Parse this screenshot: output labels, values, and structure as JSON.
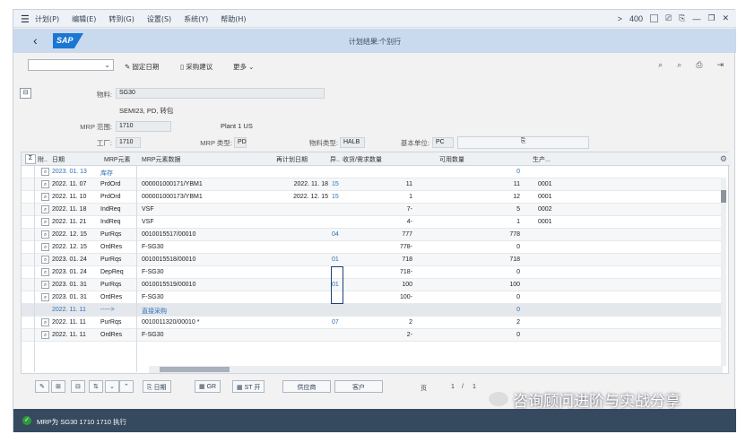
{
  "menubar": {
    "items": [
      "计划(P)",
      "编辑(E)",
      "转到(G)",
      "设置(S)",
      "系统(Y)",
      "帮助(H)"
    ],
    "right": {
      "chevron": ">",
      "zoom": "400"
    }
  },
  "header": {
    "title": "计划结果:个别行",
    "logo": "SAP"
  },
  "toolbar": {
    "fix_date": "固定日期",
    "purchase_suggestion": "采购建议",
    "more": "更多"
  },
  "form": {
    "material_label": "物料:",
    "material_value": "SG30",
    "material_desc": "SEMI23, PD, 转包",
    "mrp_area_label": "MRP 范围:",
    "mrp_area_value": "1710",
    "mrp_area_desc": "Plant 1 US",
    "plant_label": "工厂:",
    "plant_value": "1710",
    "mrp_type_label": "MRP 类型:",
    "mrp_type_value": "PD",
    "material_type_label": "物料类型:",
    "material_type_value": "HALB",
    "base_unit_label": "基本单位:",
    "base_unit_value": "PC"
  },
  "table": {
    "headers": {
      "sigma": "Σ",
      "flag": "附..",
      "date": "日期",
      "mrp_elem": "MRP元素",
      "mrp_data": "MRP元素数据",
      "resched": "再计划日期",
      "exc": "异..",
      "recv_req": "收货/需求数量",
      "avail": "可用数量",
      "prod": "生产..."
    },
    "rows": [
      {
        "date": "2023. 01. 13",
        "elem": "库存",
        "data": "",
        "resched": "",
        "exc": "",
        "qty": "",
        "avail": "0",
        "prod": "",
        "blue": true
      },
      {
        "date": "2022. 11. 07",
        "elem": "PrdOrd",
        "data": "000001000171/YBM1",
        "resched": "2022. 11. 18",
        "exc": "15",
        "qty": "11",
        "avail": "11",
        "prod": "0001"
      },
      {
        "date": "2022. 11. 10",
        "elem": "PrdOrd",
        "data": "000001000173/YBM1",
        "resched": "2022. 12. 15",
        "exc": "15",
        "qty": "1",
        "avail": "12",
        "prod": "0001"
      },
      {
        "date": "2022. 11. 18",
        "elem": "IndReq",
        "data": "VSF",
        "resched": "",
        "exc": "",
        "qty": "7-",
        "avail": "5",
        "prod": "0002"
      },
      {
        "date": "2022. 11. 21",
        "elem": "IndReq",
        "data": "VSF",
        "resched": "",
        "exc": "",
        "qty": "4-",
        "avail": "1",
        "prod": "0001"
      },
      {
        "date": "2022. 12. 15",
        "elem": "PurRqs",
        "data": "0010015517/00010",
        "resched": "",
        "exc": "04",
        "qty": "777",
        "avail": "778",
        "prod": ""
      },
      {
        "date": "2022. 12. 15",
        "elem": "OrdRes",
        "data": "F-SG30",
        "resched": "",
        "exc": "",
        "qty": "778-",
        "avail": "0",
        "prod": ""
      },
      {
        "date": "2023. 01. 24",
        "elem": "PurRqs",
        "data": "0010015518/00010",
        "resched": "",
        "exc": "01",
        "qty": "718",
        "avail": "718",
        "prod": ""
      },
      {
        "date": "2023. 01. 24",
        "elem": "DepReq",
        "data": "F-SG30",
        "resched": "",
        "exc": "",
        "qty": "718-",
        "avail": "0",
        "prod": ""
      },
      {
        "date": "2023. 01. 31",
        "elem": "PurRqs",
        "data": "0010015519/00010",
        "resched": "",
        "exc": "01",
        "qty": "100",
        "avail": "100",
        "prod": ""
      },
      {
        "date": "2023. 01. 31",
        "elem": "OrdRes",
        "data": "F-SG30",
        "resched": "",
        "exc": "",
        "qty": "100-",
        "avail": "0",
        "prod": ""
      },
      {
        "date": "2022. 11. 11",
        "elem": "----->",
        "data": "直接采购",
        "resched": "",
        "exc": "",
        "qty": "",
        "avail": "0",
        "prod": "",
        "blue": true
      },
      {
        "date": "2022. 11. 11",
        "elem": "PurRqs",
        "data": "0010011320/00010 *",
        "resched": "",
        "exc": "07",
        "qty": "2",
        "avail": "2",
        "prod": ""
      },
      {
        "date": "2022. 11. 11",
        "elem": "OrdRes",
        "data": "F-SG30",
        "resched": "",
        "exc": "",
        "qty": "2-",
        "avail": "0",
        "prod": ""
      }
    ]
  },
  "bottombar": {
    "date_btn": "日期",
    "gr_btn": "GR",
    "st_btn": "ST 开",
    "vendor_btn": "供应商",
    "customer_btn": "客户",
    "page_label": "页",
    "page_current": "1",
    "page_sep": "/",
    "page_total": "1"
  },
  "status": {
    "text": "MRP为 SG30 1710 1710 执行"
  },
  "watermark": "咨询顾问进阶与实战分享"
}
